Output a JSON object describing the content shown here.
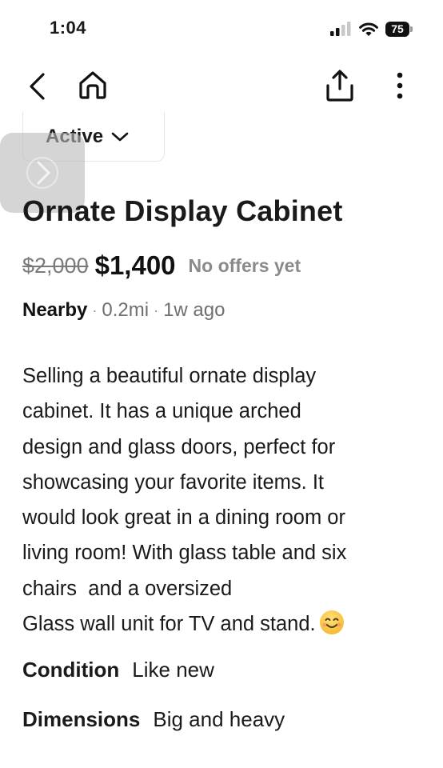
{
  "status_bar": {
    "time": "1:04",
    "battery_level": "75",
    "icons": [
      "signal-icon",
      "wifi-icon",
      "battery-icon"
    ]
  },
  "nav": {
    "icons": [
      "back-chevron-icon",
      "home-icon",
      "share-icon",
      "more-vertical-icon"
    ]
  },
  "listing": {
    "status_label": "Active",
    "title": "Ornate Display Cabinet",
    "original_price": "$2,000",
    "price": "$1,400",
    "offers_status": "No offers yet",
    "location": "Nearby",
    "distance": "0.2mi",
    "posted": "1w ago",
    "description_lines": [
      "Selling a beautiful ornate display",
      "cabinet. It has a unique arched",
      "design and glass doors, perfect for",
      "showcasing your favorite items. It",
      "would look great in a dining room or",
      "living room! With glass table and six",
      "chairs  and a oversized",
      "Glass wall unit for TV and stand."
    ],
    "condition_label": "Condition",
    "condition_value": "Like new",
    "dimensions_label": "Dimensions",
    "dimensions_value": "Big and heavy"
  },
  "colors": {
    "text": "#1a1a1a",
    "muted": "#8a8a8a",
    "overlay": "#b9b9b9"
  }
}
